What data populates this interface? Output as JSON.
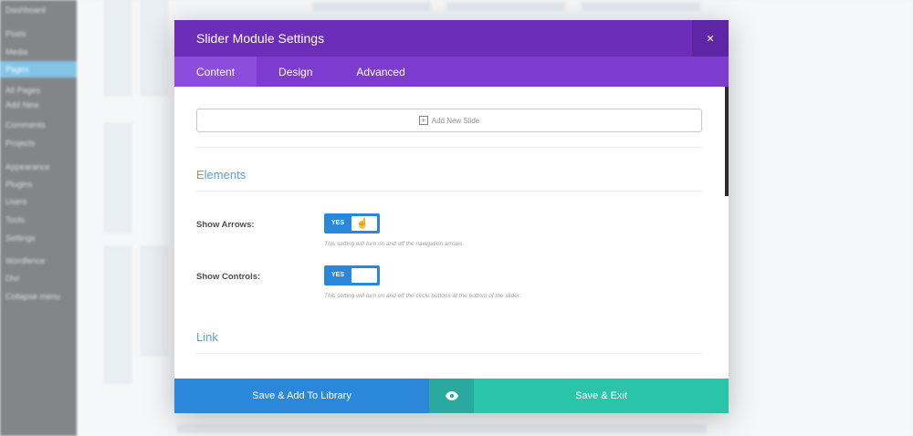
{
  "background": {
    "sidebar_items": [
      {
        "label": "Dashboard",
        "active": false
      },
      {
        "label": "Posts",
        "active": false
      },
      {
        "label": "Media",
        "active": false
      },
      {
        "label": "Pages",
        "active": true
      },
      {
        "label": "All Pages",
        "active": false
      },
      {
        "label": "Add New",
        "active": false
      },
      {
        "label": "Comments",
        "active": false
      },
      {
        "label": "Projects",
        "active": false
      },
      {
        "label": "Appearance",
        "active": false
      },
      {
        "label": "Plugins",
        "active": false
      },
      {
        "label": "Users",
        "active": false
      },
      {
        "label": "Tools",
        "active": false
      },
      {
        "label": "Settings",
        "active": false
      },
      {
        "label": "Wordfence",
        "active": false
      },
      {
        "label": "Divi",
        "active": false
      },
      {
        "label": "Collapse menu",
        "active": false
      }
    ]
  },
  "modal": {
    "title": "Slider Module Settings",
    "close_icon": "×",
    "tabs": [
      {
        "label": "Content",
        "active": true
      },
      {
        "label": "Design",
        "active": false
      },
      {
        "label": "Advanced",
        "active": false
      }
    ],
    "add_slide_label": "Add New Slide",
    "sections": {
      "elements_title": "Elements",
      "link_title": "Link"
    },
    "fields": {
      "show_arrows": {
        "label": "Show Arrows:",
        "value": "YES",
        "description": "This setting will turn on and off the navigation arrows."
      },
      "show_controls": {
        "label": "Show Controls:",
        "value": "YES",
        "description": "This setting will turn on and off the circle buttons at the bottom of the slider."
      }
    },
    "footer": {
      "save_library_label": "Save & Add To Library",
      "preview_icon": "eye-icon",
      "save_exit_label": "Save & Exit"
    }
  },
  "colors": {
    "header": "#6c2eb9",
    "tabs": "#7e3bd0",
    "primary_blue": "#2b87da",
    "teal": "#29c4a9"
  }
}
